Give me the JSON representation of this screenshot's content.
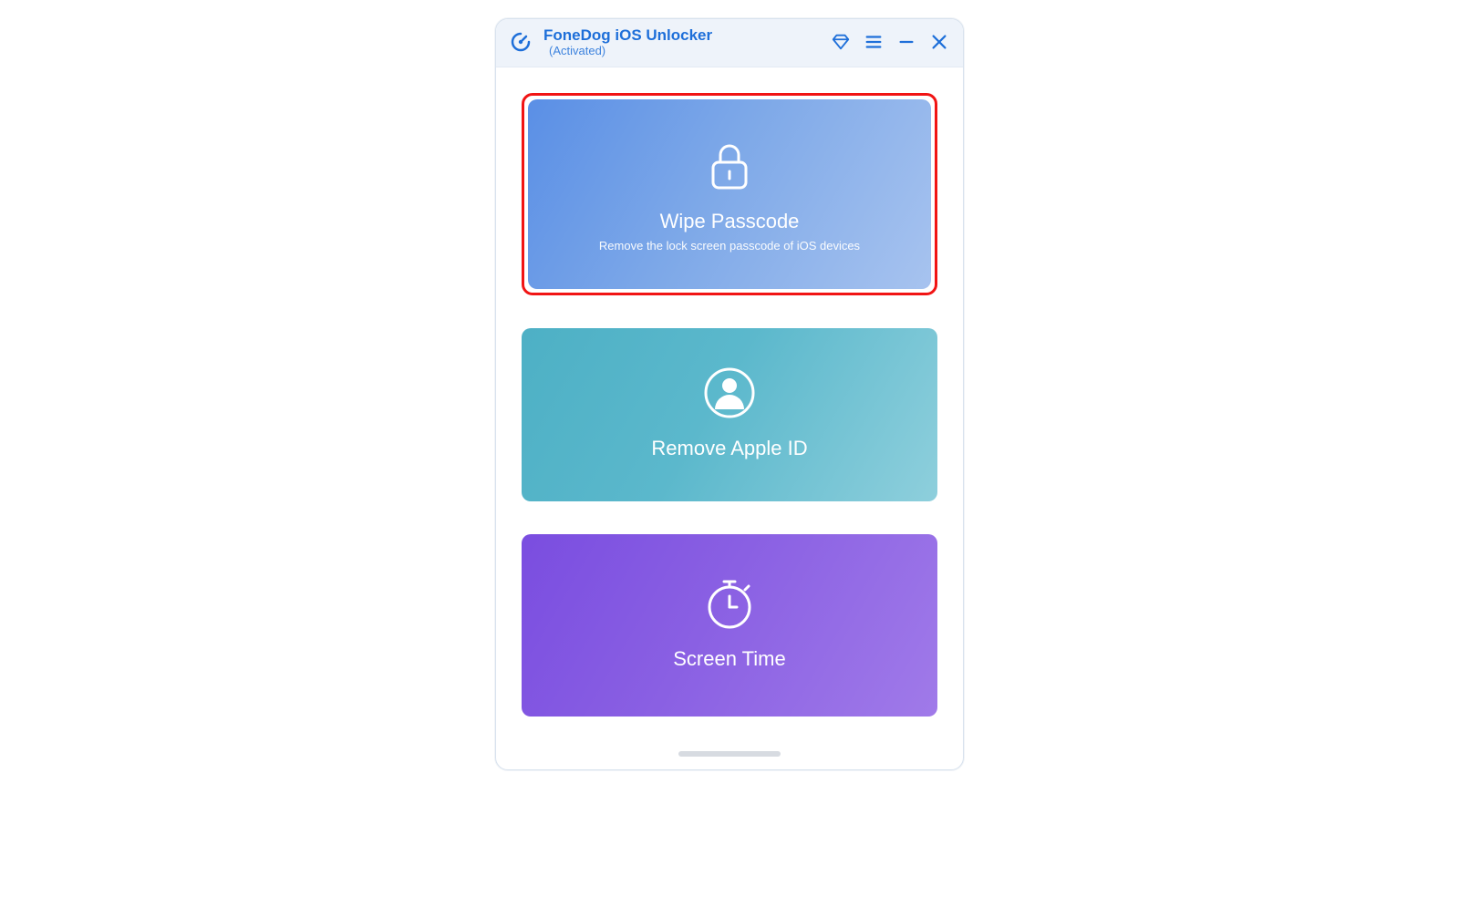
{
  "titlebar": {
    "app_name": "FoneDog iOS Unlocker",
    "status": "(Activated)",
    "icons": {
      "diamond": "diamond-icon",
      "menu": "menu-icon",
      "minimize": "minimize-icon",
      "close": "close-icon"
    }
  },
  "options": {
    "wipe_passcode": {
      "title": "Wipe Passcode",
      "subtitle": "Remove the lock screen passcode of iOS devices",
      "highlighted": true
    },
    "remove_apple_id": {
      "title": "Remove Apple ID"
    },
    "screen_time": {
      "title": "Screen Time"
    }
  },
  "colors": {
    "brand_blue": "#1e6fd9",
    "highlight_red": "#f11414",
    "card1_start": "#5a8fe6",
    "card2_start": "#4db0c5",
    "card3_start": "#7a4de0"
  }
}
